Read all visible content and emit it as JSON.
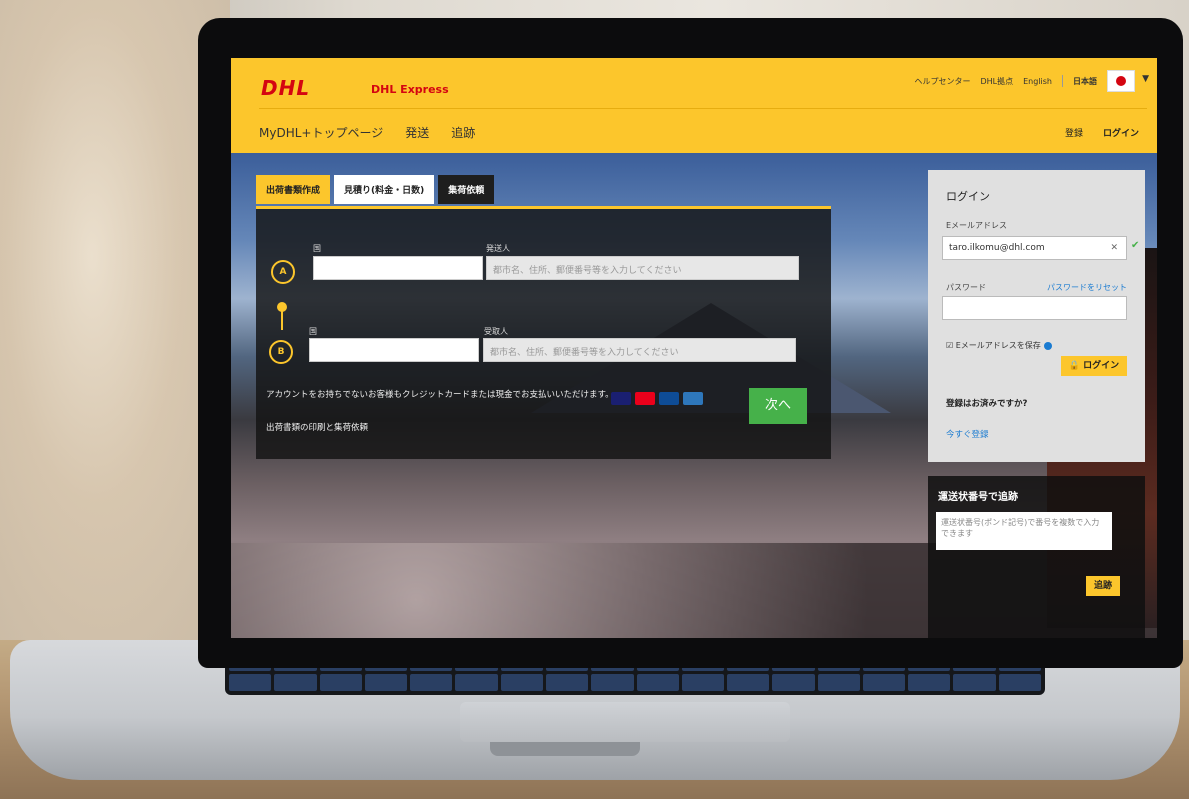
{
  "header": {
    "logo": "DHL",
    "brand": "DHL Express",
    "utility_links": [
      "ヘルプセンター",
      "DHL拠点",
      "English",
      "日本語"
    ],
    "flag_icon": "japan-flag-icon",
    "main_nav": [
      "MyDHL+トップページ",
      "発送",
      "追跡"
    ],
    "right_nav": {
      "register": "登録",
      "login": "ログイン"
    }
  },
  "tabs": [
    "出荷書類作成",
    "見積り(料金・日数)",
    "集荷依頼"
  ],
  "form": {
    "origin_country_label": "国",
    "origin_label": "発送人",
    "origin_placeholder": "都市名、住所、郵便番号等を入力してください",
    "dest_country_label": "国",
    "dest_label": "受取人",
    "dest_placeholder": "都市名、住所、郵便番号等を入力してください",
    "marker_a": "A",
    "marker_b": "B",
    "account_note": "アカウントをお持ちでないお客様もクレジットカードまたは現金でお支払いいただけます。",
    "print_note": "出荷書類の印刷と集荷依頼",
    "next_button": "次へ"
  },
  "login": {
    "title": "ログイン",
    "email_label": "Eメールアドレス",
    "email_value": "taro.ilkomu@dhl.com",
    "password_label": "パスワード",
    "reset_link": "パスワードをリセット",
    "remember_label": "Eメールアドレスを保存",
    "login_button": "ログイン",
    "first_time": "登録はお済みですか?",
    "signup_link": "今すぐ登録"
  },
  "tracking": {
    "title": "運送状番号で追跡",
    "placeholder": "運送状番号(ポンド記号)で番号を複数で入力できます",
    "button": "追跡"
  },
  "colors": {
    "dhl_yellow": "#fcc62c",
    "dhl_red": "#d40511",
    "next_green": "#46b14a",
    "link_blue": "#1a7bd1"
  }
}
